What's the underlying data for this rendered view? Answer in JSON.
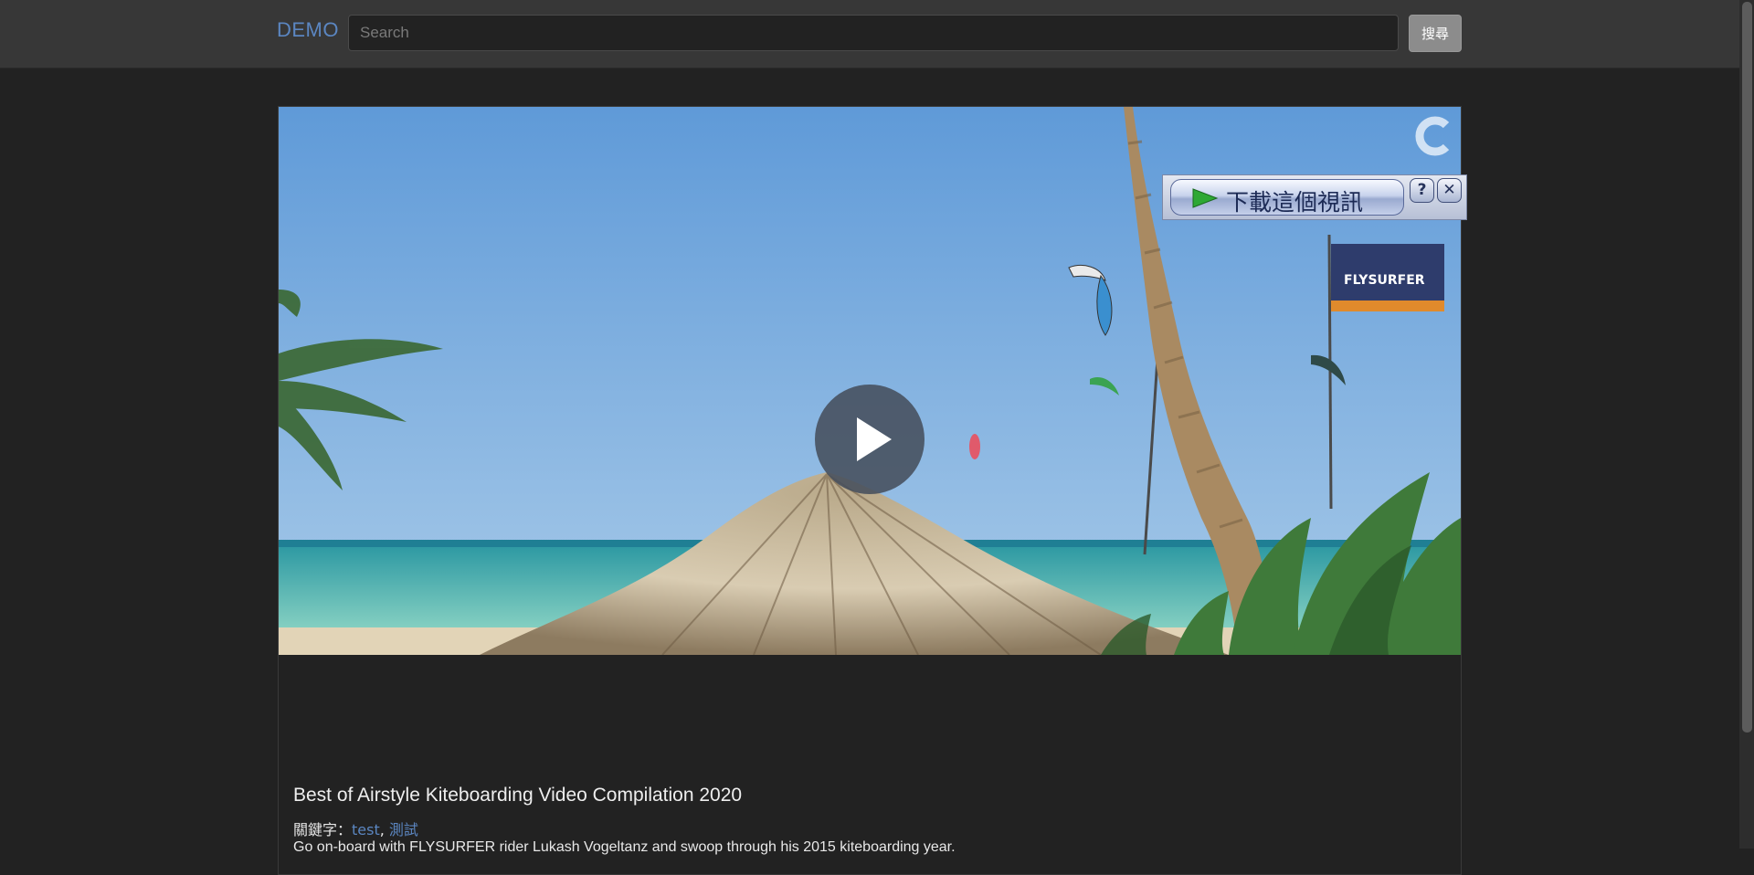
{
  "navbar": {
    "brand": "DEMO",
    "search_placeholder": "Search",
    "search_button": "搜尋"
  },
  "video": {
    "download_label": "下載這個視訊",
    "help_label": "?",
    "close_label": "✕",
    "play_icon": "play-icon",
    "colors": {
      "sky": "#6fa6dc",
      "sea": "#59bfb2",
      "sand": "#d8c8a8",
      "play_button": "#464e5c"
    }
  },
  "content": {
    "title": "Best of Airstyle Kiteboarding Video Compilation 2020",
    "keywords_label": "關鍵字：",
    "keywords": [
      "test",
      "測試"
    ],
    "keyword_separator": ", ",
    "description": "Go on-board with FLYSURFER rider Lukash Vogeltanz and swoop through his 2015 kiteboarding year."
  }
}
